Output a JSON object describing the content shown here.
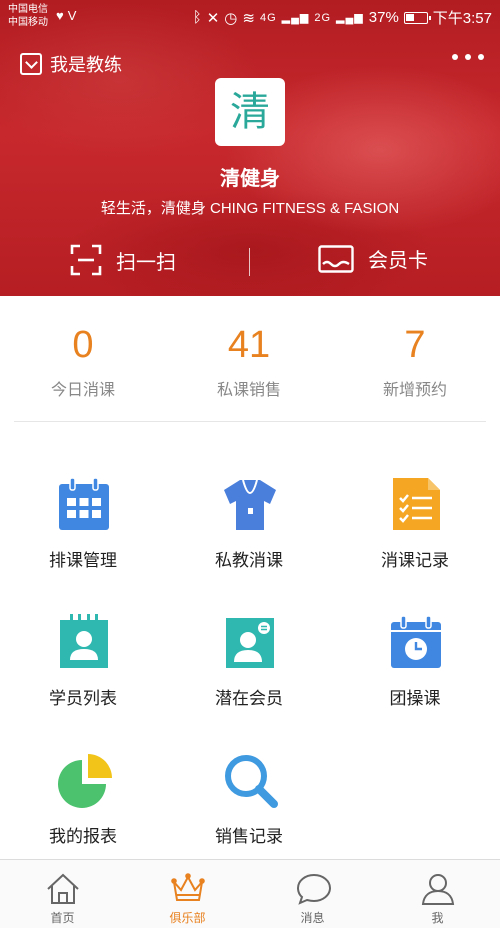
{
  "status_bar": {
    "carrier_1": "中国电信",
    "carrier_2": "中国移动",
    "network_1": "4G",
    "network_2": "2G",
    "battery": "37%",
    "time": "下午3:57"
  },
  "header": {
    "role_label": "我是教练",
    "logo_char": "清",
    "brand": "清健身",
    "slogan": "轻生活，清健身 CHING FITNESS & FASION",
    "scan_label": "扫一扫",
    "card_label": "会员卡"
  },
  "stats": [
    {
      "value": "0",
      "label": "今日消课"
    },
    {
      "value": "41",
      "label": "私课销售"
    },
    {
      "value": "7",
      "label": "新增预约"
    }
  ],
  "grid": [
    {
      "label": "排课管理",
      "icon": "calendar-grid-icon"
    },
    {
      "label": "私教消课",
      "icon": "jersey-icon"
    },
    {
      "label": "消课记录",
      "icon": "checklist-icon"
    },
    {
      "label": "学员列表",
      "icon": "student-list-icon"
    },
    {
      "label": "潜在会员",
      "icon": "potential-member-icon"
    },
    {
      "label": "团操课",
      "icon": "calendar-clock-icon"
    },
    {
      "label": "我的报表",
      "icon": "pie-chart-icon"
    },
    {
      "label": "销售记录",
      "icon": "magnifier-icon"
    }
  ],
  "tabs": [
    {
      "label": "首页",
      "icon": "home-icon",
      "active": false
    },
    {
      "label": "俱乐部",
      "icon": "crown-icon",
      "active": true
    },
    {
      "label": "消息",
      "icon": "chat-bubble-icon",
      "active": false
    },
    {
      "label": "我",
      "icon": "person-icon",
      "active": false
    }
  ],
  "colors": {
    "header_red": "#c7282d",
    "accent_orange": "#e8811f",
    "logo_teal": "#2aa89a",
    "icon_blue": "#3f87e0",
    "icon_teal": "#2fb8b0",
    "icon_orange": "#f5a623",
    "icon_green": "#4cc26e",
    "icon_yellow": "#f2c41a"
  }
}
